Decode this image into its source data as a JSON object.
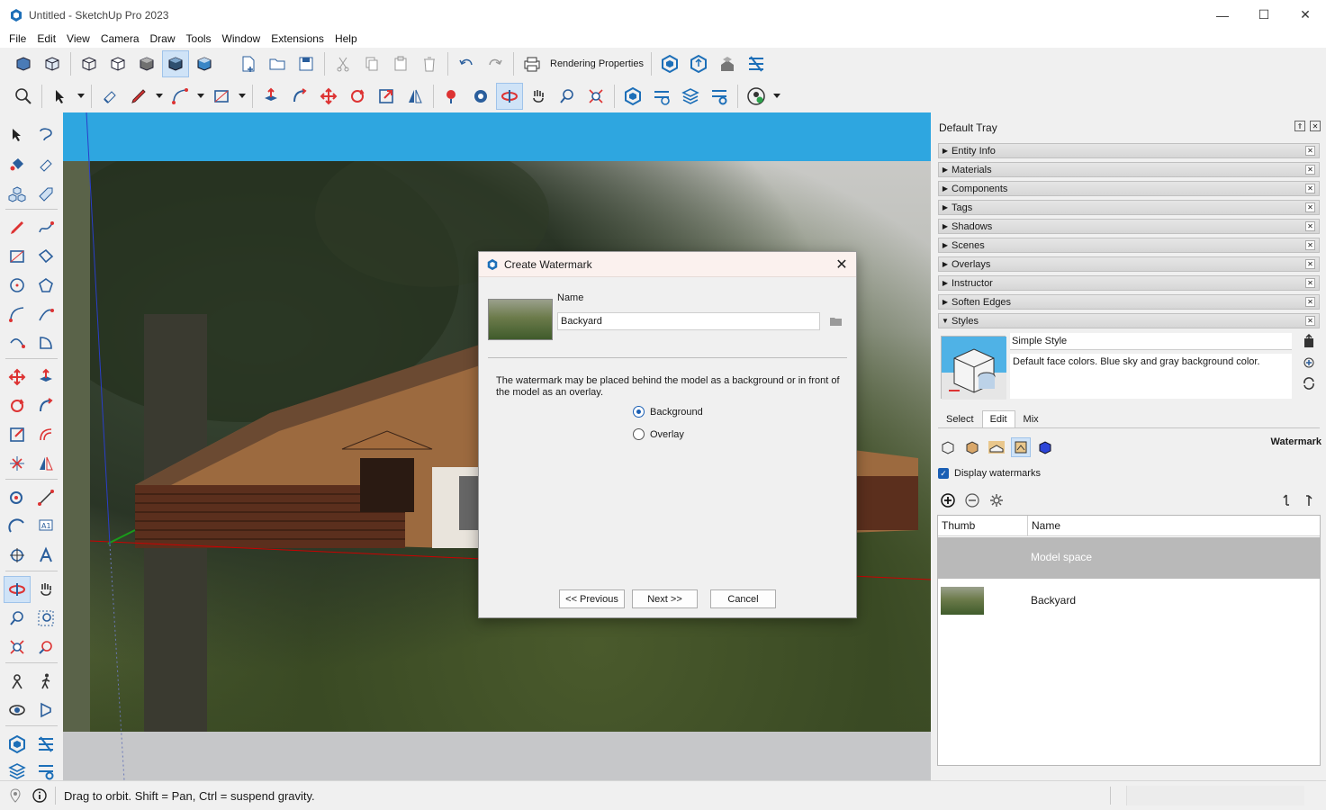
{
  "window": {
    "title": "Untitled - SketchUp Pro 2023",
    "minimize": "—",
    "maximize": "☐",
    "close": "✕"
  },
  "menu": [
    "File",
    "Edit",
    "View",
    "Camera",
    "Draw",
    "Tools",
    "Window",
    "Extensions",
    "Help"
  ],
  "toolbar1": {
    "rendering_properties_label": "Rendering Properties"
  },
  "dialog": {
    "title": "Create Watermark",
    "name_label": "Name",
    "name_value": "Backyard",
    "description": "The watermark may be placed behind the model as a background or in front of the model as an overlay.",
    "options": [
      {
        "label": "Background",
        "checked": true
      },
      {
        "label": "Overlay",
        "checked": false
      }
    ],
    "buttons": {
      "previous": "<< Previous",
      "next": "Next >>",
      "cancel": "Cancel"
    }
  },
  "tray": {
    "title": "Default Tray",
    "panels": [
      {
        "label": "Entity Info",
        "expanded": false
      },
      {
        "label": "Materials",
        "expanded": false
      },
      {
        "label": "Components",
        "expanded": false
      },
      {
        "label": "Tags",
        "expanded": false
      },
      {
        "label": "Shadows",
        "expanded": false
      },
      {
        "label": "Scenes",
        "expanded": false
      },
      {
        "label": "Overlays",
        "expanded": false
      },
      {
        "label": "Instructor",
        "expanded": false
      },
      {
        "label": "Soften Edges",
        "expanded": false
      },
      {
        "label": "Styles",
        "expanded": true
      }
    ],
    "styles": {
      "style_name": "Simple Style",
      "style_description": "Default face colors. Blue sky and gray background color.",
      "tabs": [
        "Select",
        "Edit",
        "Mix"
      ],
      "active_tab": "Edit",
      "section_label": "Watermark",
      "display_watermarks_label": "Display watermarks",
      "display_watermarks_checked": true,
      "columns": [
        "Thumb",
        "Name"
      ],
      "rows": [
        {
          "name": "Model space",
          "selected": true
        },
        {
          "name": "Backyard",
          "selected": false
        }
      ]
    }
  },
  "status": {
    "text": "Drag to orbit. Shift = Pan, Ctrl = suspend gravity."
  },
  "colors": {
    "sky": "#2ea6e0",
    "accent": "#1a5fb4",
    "background": "#c8c9cb"
  }
}
